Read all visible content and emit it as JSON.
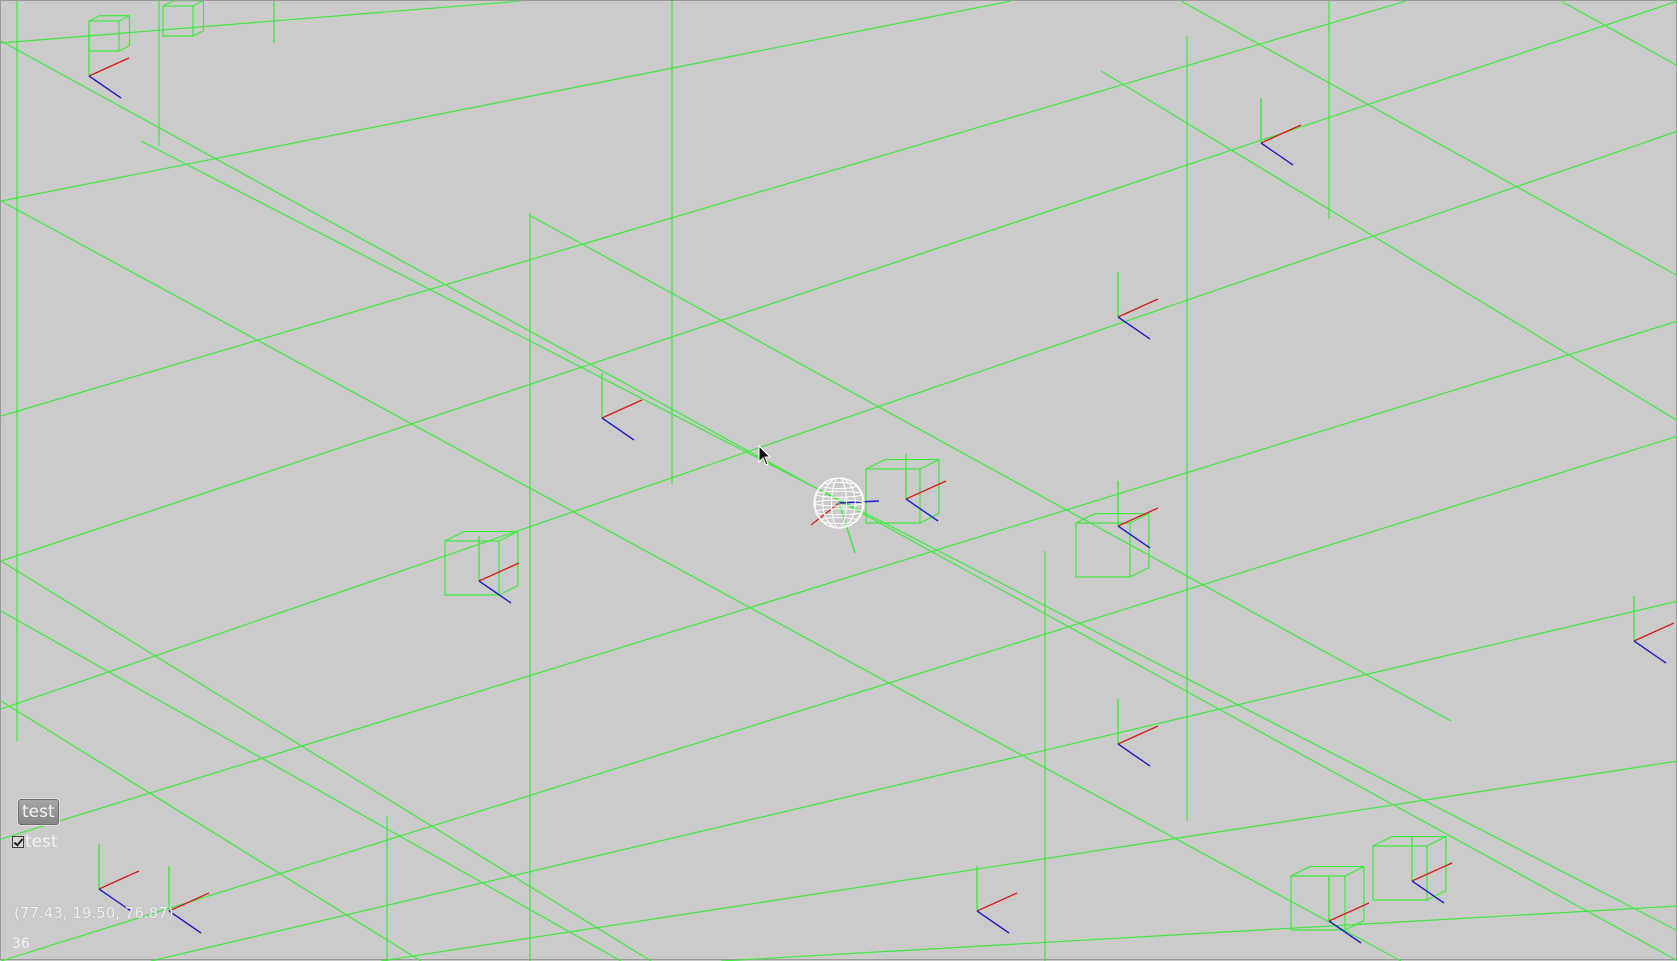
{
  "window": {
    "background": "#cbcbcb"
  },
  "scene": {
    "grid_color": "#3fea3f",
    "axis_colors": {
      "x": "#d42020",
      "y": "#2a9a2a",
      "z": "#2020c8"
    },
    "sphere_color": "#ffffff"
  },
  "widgets": {
    "test_button_label": "test",
    "test_checkbox_label": "test",
    "test_checkbox_checked": true
  },
  "status": {
    "coordinates": "(77.43, 19.50, 76.87)",
    "fps": "36"
  },
  "icons": {
    "cursor": "arrow-cursor-icon",
    "checkmark": "checkmark-icon"
  }
}
